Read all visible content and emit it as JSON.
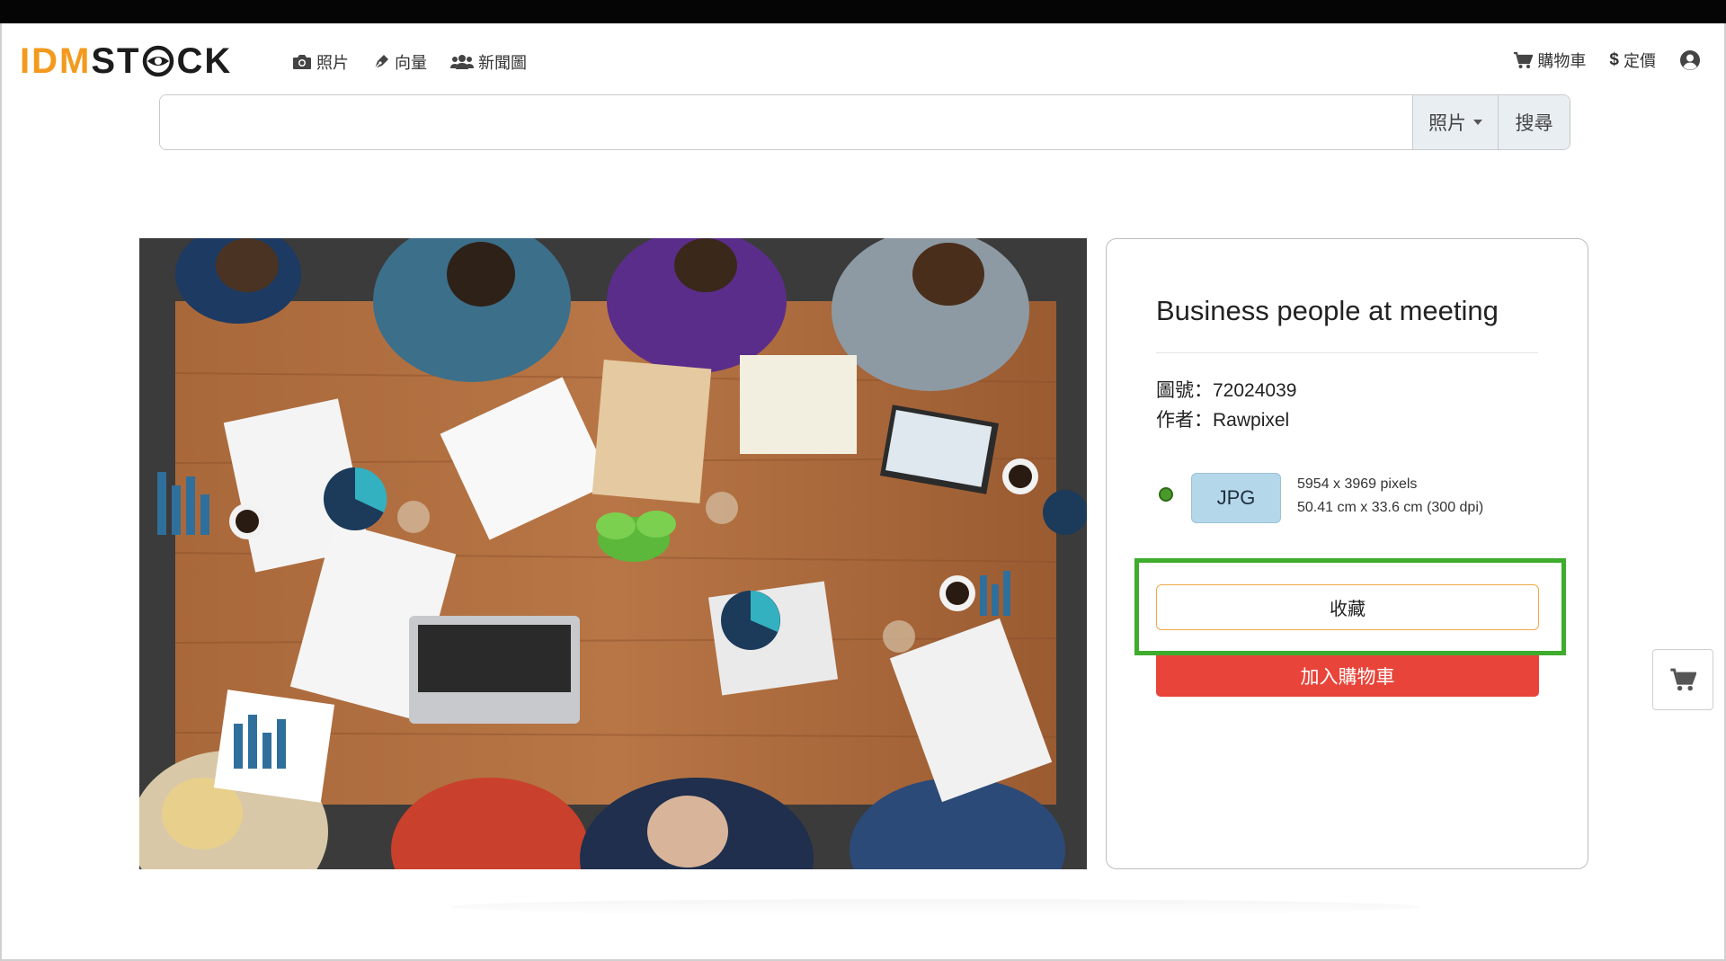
{
  "header": {
    "logo": {
      "part1": "IDM",
      "part2": "ST",
      "part3": "CK"
    },
    "nav_left": [
      {
        "icon": "camera-icon",
        "label": "照片"
      },
      {
        "icon": "pen-nib-icon",
        "label": "向量"
      },
      {
        "icon": "users-icon",
        "label": "新聞圖"
      }
    ],
    "nav_right": [
      {
        "icon": "cart-icon",
        "label": "購物車"
      },
      {
        "icon": "dollar-icon",
        "label": "定價"
      },
      {
        "icon": "user-circle-icon",
        "label": ""
      }
    ]
  },
  "search": {
    "value": "",
    "placeholder": "",
    "type_selected": "照片",
    "button_label": "搜尋"
  },
  "photo": {
    "alt": "Business people at meeting"
  },
  "details": {
    "title": "Business people at meeting",
    "id_label": "圖號：72024039",
    "author_label": "作者：Rawpixel",
    "format": "JPG",
    "format_selected": true,
    "size_pixels": "5954 x 3969 pixels",
    "size_cm": "50.41 cm x 33.6 cm (300 dpi)",
    "favorite_label": "收藏",
    "add_to_cart_label": "加入購物車"
  },
  "colors": {
    "logo_orange": "#f39a1e",
    "highlight_green": "#3eac2c",
    "cart_red": "#e8443a",
    "format_blue": "#b4d7ea"
  }
}
